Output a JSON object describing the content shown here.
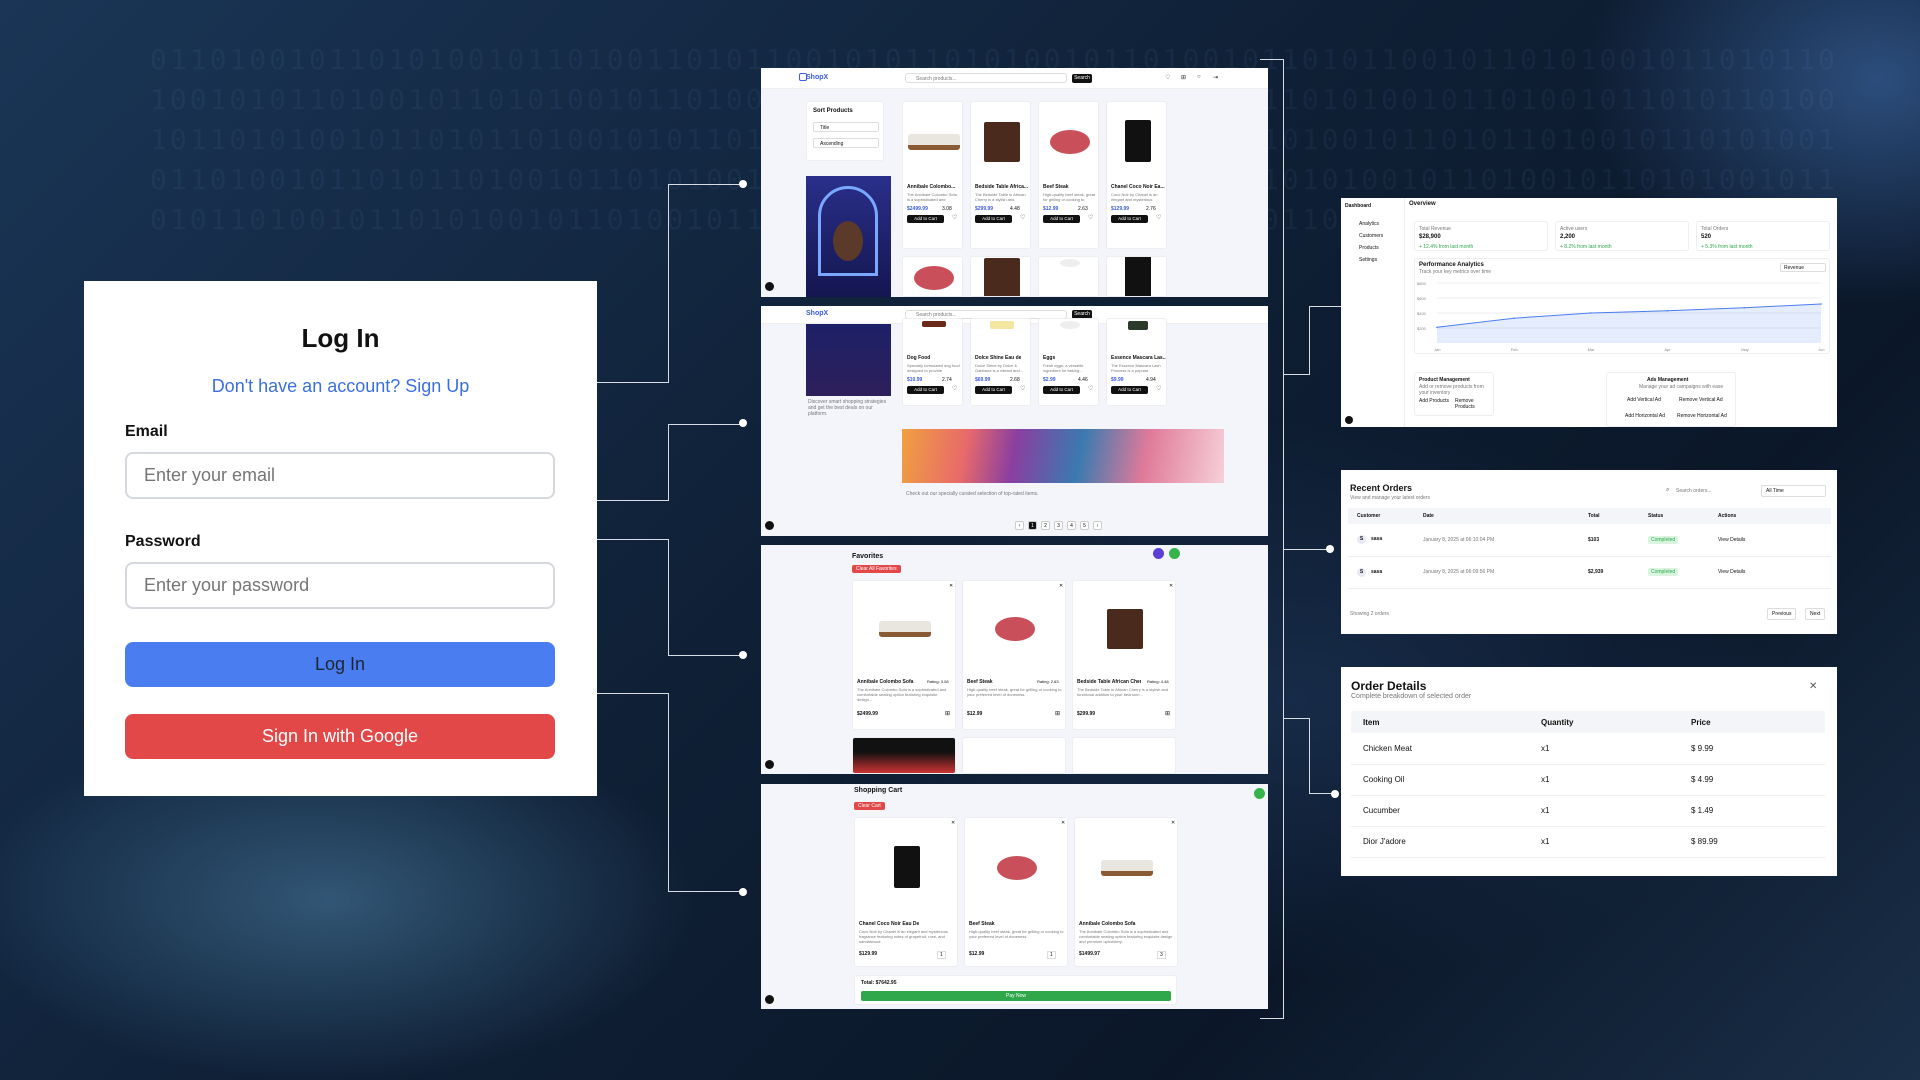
{
  "login": {
    "title": "Log In",
    "signup_text": "Don't have an account? Sign Up",
    "email_label": "Email",
    "email_placeholder": "Enter your email",
    "password_label": "Password",
    "password_placeholder": "Enter your password",
    "login_button": "Log In",
    "google_button": "Sign In with Google"
  },
  "shop": {
    "brand": "ShopX",
    "search_placeholder": "Search products...",
    "search_button": "Search",
    "sort_title": "Sort Products",
    "sort_by": "Title",
    "sort_order": "Ascending",
    "products_row1": [
      {
        "name": "Annibale Colombo...",
        "desc": "The Annibale Colombo Sofa is a sophisticated and",
        "price": "$2499.99",
        "rating": "3.08"
      },
      {
        "name": "Bedside Table Africa...",
        "desc": "The Bedside Table in African Cherry is a stylish and",
        "price": "$299.99",
        "rating": "4.48"
      },
      {
        "name": "Beef Steak",
        "desc": "High-quality beef steak, great for grilling or cooking to",
        "price": "$12.99",
        "rating": "2.63"
      },
      {
        "name": "Chanel Coco Noir Ea...",
        "desc": "Coco Noir by Chanel is an elegant and mysterious",
        "price": "$129.99",
        "rating": "2.76"
      }
    ],
    "add_to_cart": "Add to Cart",
    "products_row2": [
      {
        "name": "Dog Food",
        "desc": "Specially formulated dog food designed to provide essentia...",
        "price": "$10.99",
        "rating": "2.74"
      },
      {
        "name": "Dolce Shine Eau de",
        "desc": "Dolce Shine by Dolce & Gabbana is a vibrant and...",
        "price": "$69.99",
        "rating": "2.68"
      },
      {
        "name": "Eggs",
        "desc": "Fresh eggs, a versatile ingredient for baking...",
        "price": "$2.99",
        "rating": "4.46"
      },
      {
        "name": "Essence Mascara Las...",
        "desc": "The Essence Mascara Lash Princess is a popular mascar...",
        "price": "$9.99",
        "rating": "4.94"
      }
    ],
    "promo_text": "Discover smart shopping strategies and get the best deals on our platform.",
    "banner_caption": "Check out our specially curated selection of top-rated items.",
    "pages": [
      "1",
      "2",
      "3",
      "4",
      "5"
    ]
  },
  "favorites": {
    "title": "Favorites",
    "clear": "Clear All Favorites",
    "items": [
      {
        "name": "Annibale Colombo Sofa",
        "rating": "Rating: 3.08",
        "desc": "The Annibale Colombo Sofa is a sophisticated and comfortable seating option featuring exquisite design...",
        "price": "$2499.99"
      },
      {
        "name": "Beef Steak",
        "rating": "Rating: 2.63",
        "desc": "High-quality beef steak, great for grilling or cooking to your preferred level of doneness.",
        "price": "$12.99"
      },
      {
        "name": "Bedside Table African Cherry",
        "rating": "Rating: 4.48",
        "desc": "The Bedside Table in African Cherry is a stylish and functional addition to your bedroom...",
        "price": "$299.99"
      }
    ]
  },
  "cart": {
    "title": "Shopping Cart",
    "clear": "Clear Cart",
    "items": [
      {
        "name": "Chanel Coco Noir Eau De",
        "desc": "Coco Noir by Chanel is an elegant and mysterious fragrance featuring notes of grapefruit, rose, and sandalwood.",
        "price": "$129.99",
        "qty": "1"
      },
      {
        "name": "Beef Steak",
        "desc": "High-quality beef steak, great for grilling or cooking to your preferred level of doneness.",
        "price": "$12.99",
        "qty": "1"
      },
      {
        "name": "Annibale Colombo Sofa",
        "desc": "The Annibale Colombo Sofa is a sophisticated and comfortable seating option featuring exquisite design and premium upholstery.",
        "price": "$1499.97",
        "qty": "3"
      }
    ],
    "total": "Total: $7642.95",
    "pay": "Pay Now"
  },
  "dashboard": {
    "brand": "Dashboard",
    "nav": [
      "Analytics",
      "Customers",
      "Products",
      "Settings"
    ],
    "header": "Overview",
    "stats": [
      {
        "label": "Total Revenue",
        "value": "$28,900",
        "delta": "+ 12.4% from last month"
      },
      {
        "label": "Active users",
        "value": "2,200",
        "delta": "+ 8.2% from last month"
      },
      {
        "label": "Total Orders",
        "value": "520",
        "delta": "+ 5.3% from last month"
      }
    ],
    "analytics_title": "Performance Analytics",
    "analytics_sub": "Track your key metrics over time",
    "metric": "Revenue",
    "y_ticks": [
      "$800",
      "$600",
      "$400",
      "$200"
    ],
    "months": [
      "Jan",
      "Feb",
      "Mar",
      "Apr",
      "May",
      "Jun"
    ],
    "product_mgmt": "Product Management",
    "product_mgmt_sub": "Add or remove products from your inventory",
    "add_products": "Add Products",
    "remove_products": "Remove Products",
    "ads_mgmt": "Ads Management",
    "ads_mgmt_sub": "Manage your ad campaigns with ease",
    "add_vertical": "Add Vertical Ad",
    "remove_vertical": "Remove Vertical Ad",
    "add_horizontal": "Add Horizontal Ad",
    "remove_horizontal": "Remove Horizontal Ad"
  },
  "chart_data": {
    "type": "area",
    "title": "Performance Analytics",
    "x": [
      "Jan",
      "Feb",
      "Mar",
      "Apr",
      "May",
      "Jun"
    ],
    "series": [
      {
        "name": "Revenue",
        "values": [
          210,
          330,
          400,
          430,
          470,
          520
        ]
      }
    ],
    "ylim": [
      0,
      800
    ],
    "color": "#4a7ef0"
  },
  "orders": {
    "title": "Recent Orders",
    "subtitle": "View and manage your latest orders",
    "search_placeholder": "Search orders...",
    "filter": "All Time",
    "columns": [
      "Customer",
      "Date",
      "Total",
      "Status",
      "Actions"
    ],
    "rows": [
      {
        "avatar": "S",
        "customer": "sasa",
        "date": "January 8, 2025 at 06:10:04 PM",
        "total": "$103",
        "status": "Completed",
        "action": "View Details"
      },
      {
        "avatar": "S",
        "customer": "sasa",
        "date": "January 8, 2025 at 06:09:56 PM",
        "total": "$2,939",
        "status": "Completed",
        "action": "View Details"
      }
    ],
    "footer": "Showing 2 orders",
    "prev": "Previous",
    "next": "Next"
  },
  "order_details": {
    "title": "Order Details",
    "subtitle": "Complete breakdown of selected order",
    "columns": [
      "Item",
      "Quantity",
      "Price"
    ],
    "rows": [
      {
        "item": "Chicken Meat",
        "qty": "x1",
        "price": "$ 9.99"
      },
      {
        "item": "Cooking Oil",
        "qty": "x1",
        "price": "$ 4.99"
      },
      {
        "item": "Cucumber",
        "qty": "x1",
        "price": "$ 1.49"
      },
      {
        "item": "Dior J'adore",
        "qty": "x1",
        "price": "$ 89.99"
      }
    ]
  },
  "colors": {
    "accent": "#4a7ef0",
    "danger": "#e24848",
    "success": "#2ea84a",
    "dark": "#111111"
  }
}
